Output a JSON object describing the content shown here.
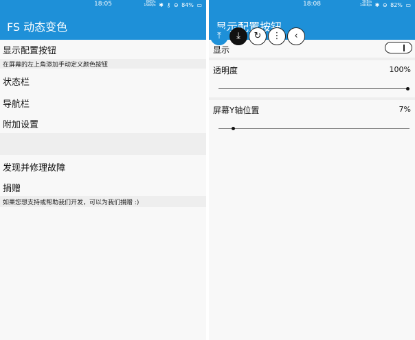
{
  "left": {
    "status": {
      "time": "18:05",
      "net_up": "6KB/s",
      "net_down": "15KB/s",
      "battery": "84%"
    },
    "appbar_title": "FS 动态变色",
    "items": [
      {
        "label": "显示配置按钮",
        "sub": "在屏幕的左上角添加手动定义颜色按钮"
      },
      {
        "label": "状态栏"
      },
      {
        "label": "导航栏"
      },
      {
        "label": "附加设置"
      },
      {
        "label": "发现并修理故障"
      },
      {
        "label": "捐赠",
        "sub": "如果您想支持或帮助我们开发，可以为我们捐赠 :)"
      }
    ]
  },
  "right": {
    "status": {
      "time": "18:08",
      "net_up": "3KB/s",
      "net_down": "14KB/s",
      "battery": "82%"
    },
    "appbar_title": "显示配置按钮",
    "show_label": "显示",
    "show_on": true,
    "opacity_label": "透明度",
    "opacity_value": "100%",
    "opacity_fraction": 1.0,
    "ypos_label": "屏幕Y轴位置",
    "ypos_value": "7%",
    "ypos_fraction": 0.07,
    "floating_buttons": [
      "pin-icon",
      "download-icon",
      "refresh-icon",
      "more-vertical-icon",
      "back-icon"
    ]
  },
  "colors": {
    "accent": "#1e90d8",
    "background": "#f8f8f8",
    "divider_block": "#eeeeee"
  }
}
